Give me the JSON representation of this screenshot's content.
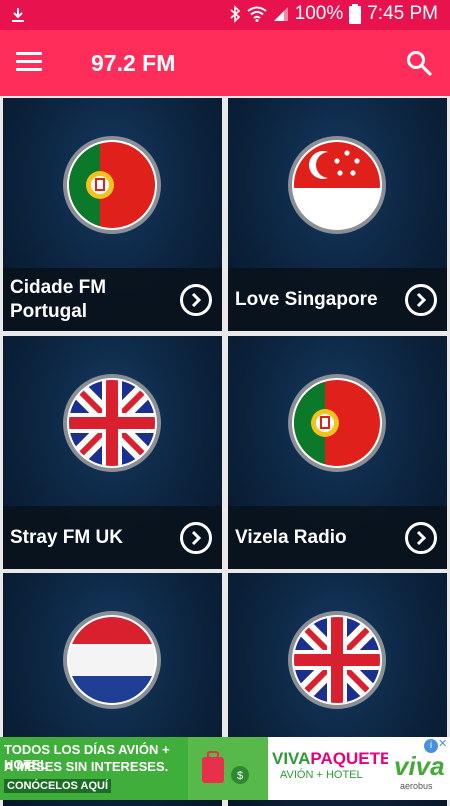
{
  "status": {
    "battery": "100%",
    "time": "7:45 PM"
  },
  "appbar": {
    "title": "97.2 FM"
  },
  "stations": [
    {
      "name": "Cidade FM Portugal",
      "flag": "portugal-flag-icon"
    },
    {
      "name": "Love Singapore",
      "flag": "singapore-flag-icon"
    },
    {
      "name": "Stray FM UK",
      "flag": "uk-flag-icon"
    },
    {
      "name": "Vizela Radio",
      "flag": "portugal-flag-icon"
    },
    {
      "name": "",
      "flag": "netherlands-flag-icon"
    },
    {
      "name": "",
      "flag": "uk-flag-icon"
    }
  ],
  "ad": {
    "line1": "TODOS LOS DÍAS AVIÓN + HOTEL",
    "line2": "A MESES SIN INTERESES.",
    "cta": "CONÓCELOS AQUÍ",
    "brand_viva": "VIVA",
    "brand_paquetes": "PAQUETES",
    "brand_sub": "AVIÓN + HOTEL",
    "logo": "viva",
    "logo_sub": "aerobus"
  },
  "colors": {
    "statusbar": "#e8134e",
    "appbar": "#ff2d5a",
    "card_bg": "#0d2744"
  }
}
